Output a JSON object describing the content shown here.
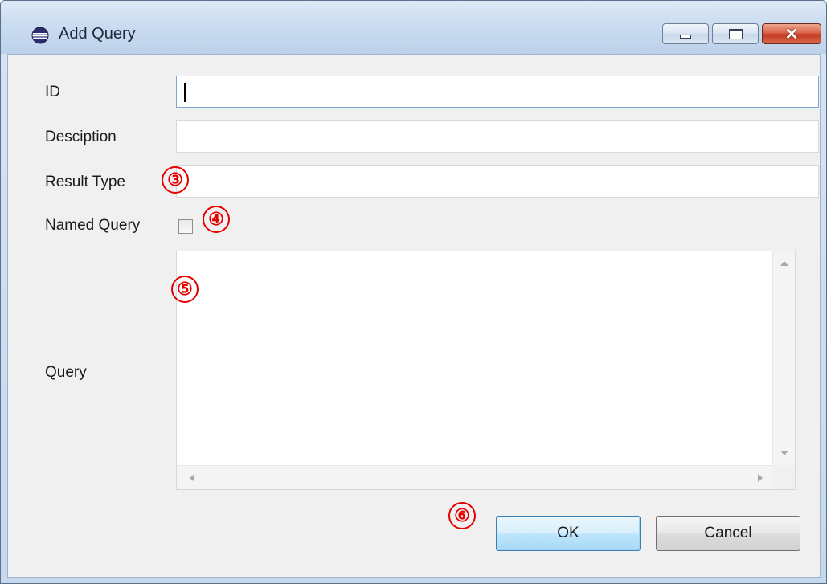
{
  "window": {
    "title": "Add Query"
  },
  "form": {
    "id_label": "ID",
    "id_value": "",
    "description_label": "Desciption",
    "description_value": "",
    "result_type_label": "Result Type",
    "result_type_value": "",
    "named_query_label": "Named Query",
    "named_query_checked": false,
    "query_label": "Query",
    "query_value": ""
  },
  "annotations": {
    "marker_3": "③",
    "marker_4": "④",
    "marker_5": "⑤",
    "marker_6": "⑥"
  },
  "buttons": {
    "ok_label": "OK",
    "cancel_label": "Cancel"
  },
  "icons": {
    "app": "eclipse-globe-icon",
    "minimize": "minimize-icon",
    "maximize": "maximize-icon",
    "close": "close-icon"
  },
  "colors": {
    "annotation": "#e60000",
    "close_button": "#c23a1f",
    "ok_focus": "#3c7fb1"
  }
}
